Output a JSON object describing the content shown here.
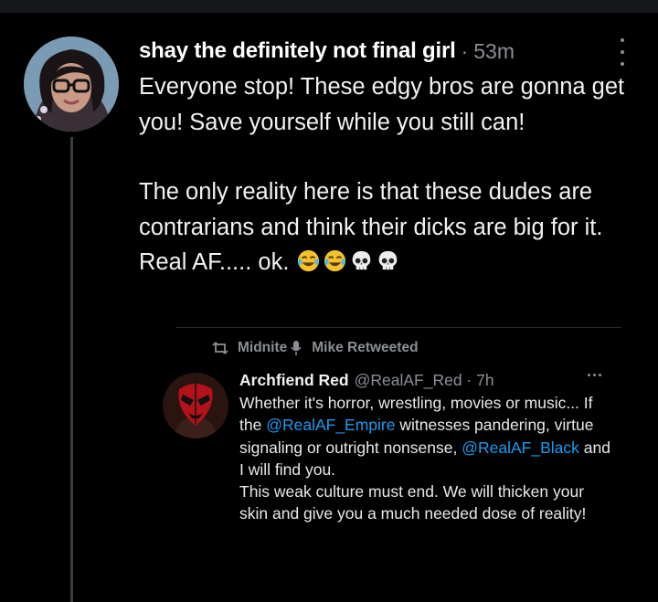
{
  "post": {
    "author_name": "shay the definitely not final girl",
    "separator": "·",
    "time": "53m",
    "paragraph1": "Everyone stop! These edgy bros are gonna get you! Save yourself while you still can!",
    "paragraph2_text": "The only reality here is that these dudes are contrarians and think their dicks are big for it. Real AF..... ok.",
    "emojis": [
      "face-with-tears-of-joy",
      "face-with-tears-of-joy",
      "skull",
      "skull"
    ]
  },
  "retweet": {
    "retweeter_part1": "Midnite",
    "retweeter_part2": "Mike Retweeted"
  },
  "quoted": {
    "author_name": "Archfiend Red",
    "handle_time": "@RealAF_Red · 7h",
    "text_part1": "Whether it's horror, wrestling, movies or music... If the ",
    "mention1": "@RealAF_Empire",
    "text_part2": " witnesses pandering, virtue signaling or outright nonsense, ",
    "mention2": "@RealAF_Black",
    "text_part3": " and I will find you.",
    "text_part4": "This weak culture must end. We will thicken your skin and give you a much needed dose of reality!"
  },
  "colors": {
    "background": "#000000",
    "text": "#e7e9ea",
    "muted": "#8b8f94",
    "link": "#1d9bf0",
    "thread_line": "#3a3d41"
  }
}
